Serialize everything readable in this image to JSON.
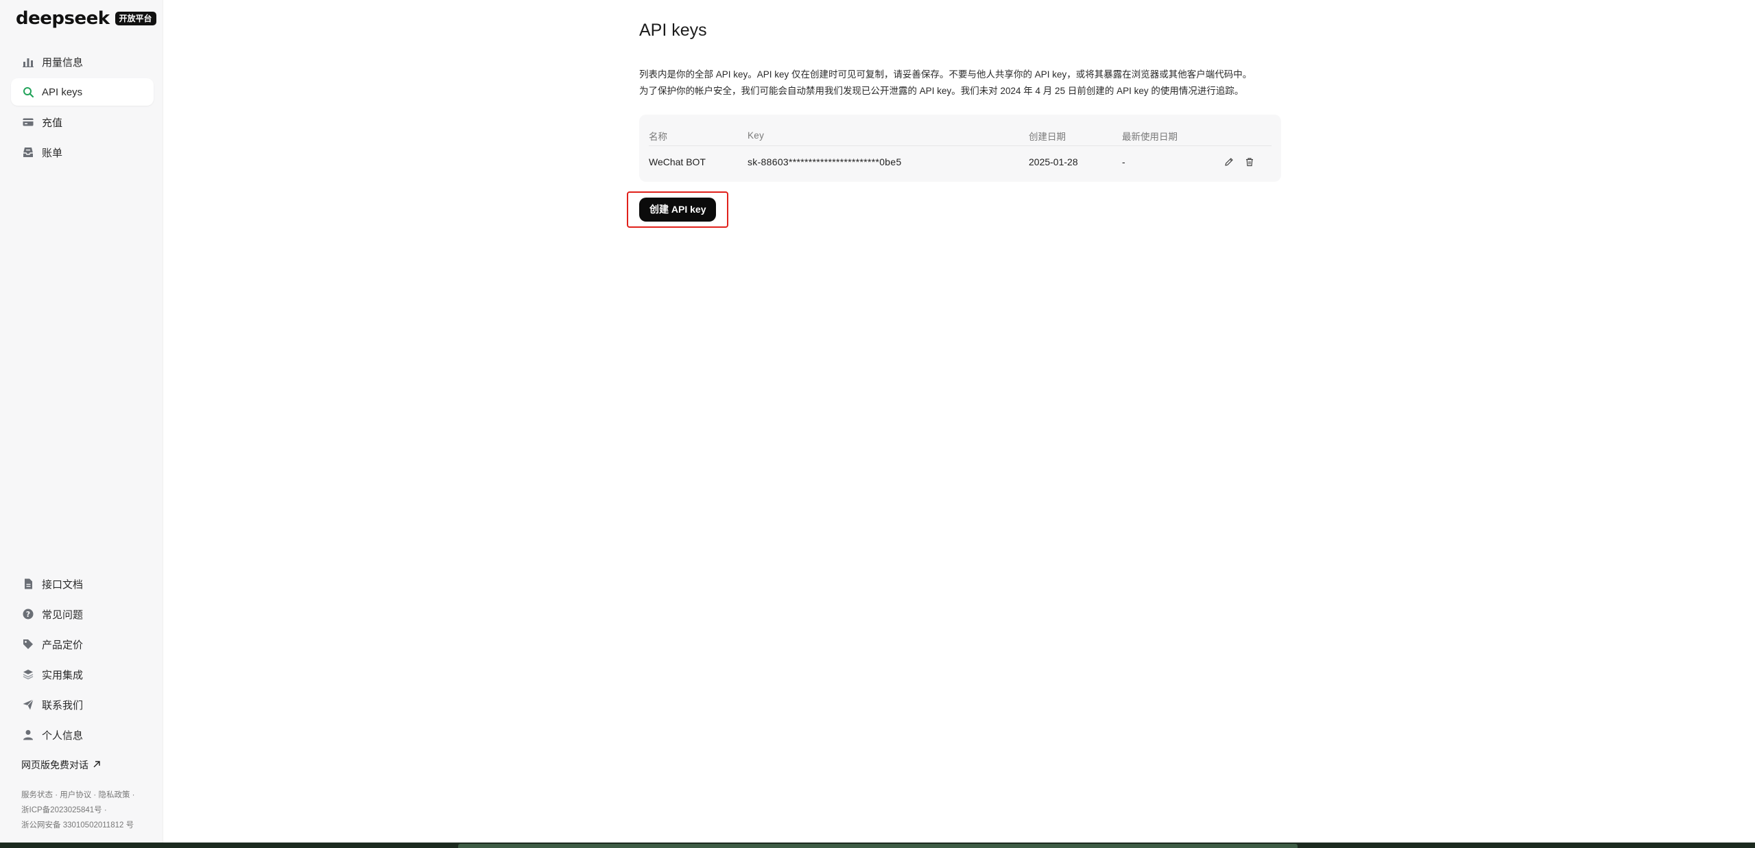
{
  "brand": {
    "name": "deepseek",
    "badge": "开放平台"
  },
  "sidebar": {
    "items": [
      {
        "label": "用量信息",
        "icon": "bar-chart-icon",
        "active": false
      },
      {
        "label": "API keys",
        "icon": "search-icon",
        "active": true
      },
      {
        "label": "充值",
        "icon": "wallet-icon",
        "active": false
      },
      {
        "label": "账单",
        "icon": "inbox-icon",
        "active": false
      }
    ],
    "bottom_items": [
      {
        "label": "接口文档",
        "icon": "document-icon"
      },
      {
        "label": "常见问题",
        "icon": "question-icon"
      },
      {
        "label": "产品定价",
        "icon": "tag-icon"
      },
      {
        "label": "实用集成",
        "icon": "layers-icon"
      },
      {
        "label": "联系我们",
        "icon": "send-icon"
      },
      {
        "label": "个人信息",
        "icon": "user-icon"
      }
    ],
    "web_chat_label": "网页版免费对话",
    "footer": {
      "status": "服务状态",
      "terms": "用户协议",
      "privacy": "隐私政策",
      "icp": "浙ICP备2023025841号",
      "police": "浙公网安备 33010502011812 号"
    }
  },
  "main": {
    "title": "API keys",
    "description_line1": "列表内是你的全部 API key。API key 仅在创建时可见可复制，请妥善保存。不要与他人共享你的 API key，或将其暴露在浏览器或其他客户端代码中。",
    "description_line2": "为了保护你的帐户安全，我们可能会自动禁用我们发现已公开泄露的 API key。我们未对 2024 年 4 月 25 日前创建的 API key 的使用情况进行追踪。",
    "table": {
      "headers": {
        "name": "名称",
        "key": "Key",
        "created": "创建日期",
        "last_used": "最新使用日期"
      },
      "rows": [
        {
          "name": "WeChat BOT",
          "key": "sk-88603***********************0be5",
          "created": "2025-01-28",
          "last_used": "-"
        }
      ]
    },
    "create_button": "创建 API key"
  },
  "colors": {
    "accent_active": "#22a35a",
    "icon_gray": "#6b6f76",
    "highlight_box": "#e0201a",
    "button_bg": "#0b0b0b"
  }
}
